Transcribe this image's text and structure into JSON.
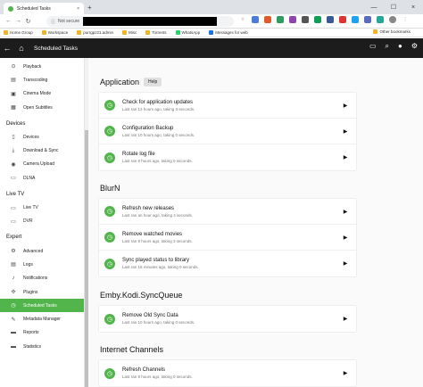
{
  "browser": {
    "tab_title": "Scheduled Tasks",
    "tab_close": "×",
    "new_tab": "+",
    "window_controls": [
      "—",
      "☐",
      "×"
    ],
    "security": "Not secure",
    "bookmarks": [
      "Home Group",
      "Workspace",
      "purrgpz21.admin",
      "Misc",
      "Torrents",
      "WhatsApp",
      "Messages for web"
    ],
    "other_bookmarks": "Other bookmarks"
  },
  "header": {
    "title": "Scheduled Tasks"
  },
  "sidebar": {
    "top_items": [
      {
        "label": "Playback",
        "icon": "play-icon"
      },
      {
        "label": "Transcoding",
        "icon": "transcode-icon"
      },
      {
        "label": "Cinema Mode",
        "icon": "cinema-icon"
      },
      {
        "label": "Open Subtitles",
        "icon": "subtitles-icon"
      }
    ],
    "devices_header": "Devices",
    "devices_items": [
      {
        "label": "Devices",
        "icon": "devices-icon"
      },
      {
        "label": "Download & Sync",
        "icon": "download-icon"
      },
      {
        "label": "Camera Upload",
        "icon": "camera-icon"
      },
      {
        "label": "DLNA",
        "icon": "dlna-icon"
      }
    ],
    "livetv_header": "Live TV",
    "livetv_items": [
      {
        "label": "Live TV",
        "icon": "tv-icon"
      },
      {
        "label": "DVR",
        "icon": "dvr-icon"
      }
    ],
    "expert_header": "Expert",
    "expert_items": [
      {
        "label": "Advanced",
        "icon": "gear-icon"
      },
      {
        "label": "Logs",
        "icon": "logs-icon"
      },
      {
        "label": "Notifications",
        "icon": "bell-icon"
      },
      {
        "label": "Plugins",
        "icon": "plugins-icon"
      },
      {
        "label": "Scheduled Tasks",
        "icon": "tasks-icon"
      },
      {
        "label": "Metadata Manager",
        "icon": "edit-icon"
      },
      {
        "label": "Reports",
        "icon": "folder-icon"
      },
      {
        "label": "Statistics",
        "icon": "folder-icon"
      }
    ]
  },
  "main": {
    "help_label": "Help",
    "sections": [
      {
        "title": "Application",
        "tasks": [
          {
            "name": "Check for application updates",
            "sub": "Last ran 13 hours ago, taking 3 seconds."
          },
          {
            "name": "Configuration Backup",
            "sub": "Last ran 10 hours ago, taking 0 seconds."
          },
          {
            "name": "Rotate log file",
            "sub": "Last ran 8 hours ago, taking 0 seconds."
          }
        ]
      },
      {
        "title": "BlurN",
        "tasks": [
          {
            "name": "Refresh new releases",
            "sub": "Last ran an hour ago, taking 4 seconds."
          },
          {
            "name": "Remove watched movies",
            "sub": "Last ran 8 hours ago, taking 3 seconds."
          },
          {
            "name": "Sync played status to library",
            "sub": "Last ran 15 minutes ago, taking 0 seconds."
          }
        ]
      },
      {
        "title": "Emby.Kodi.SyncQueue",
        "tasks": [
          {
            "name": "Remove Old Sync Data",
            "sub": "Last ran 10 hours ago, taking 0 seconds."
          }
        ]
      },
      {
        "title": "Internet Channels",
        "tasks": [
          {
            "name": "Refresh Channels",
            "sub": "Last ran 8 hours ago, taking 0 seconds."
          }
        ]
      }
    ]
  },
  "colors": {
    "accent": "#52b54b",
    "header_bg": "#1c1c1c"
  }
}
